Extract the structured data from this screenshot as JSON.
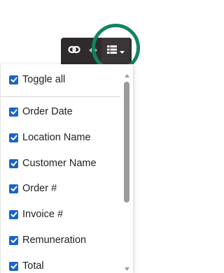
{
  "toolbar": {
    "buttons": [
      {
        "name": "link-toggle",
        "icon": "link-icon"
      },
      {
        "name": "resize",
        "icon": "resize-arrows-icon"
      },
      {
        "name": "column-picker",
        "icon": "grid-icon"
      }
    ]
  },
  "column_menu": {
    "toggle_all": {
      "label": "Toggle all",
      "checked": true
    },
    "columns": [
      {
        "label": "Order Date",
        "checked": true
      },
      {
        "label": "Location Name",
        "checked": true
      },
      {
        "label": "Customer Name",
        "checked": true
      },
      {
        "label": "Order #",
        "checked": true
      },
      {
        "label": "Invoice #",
        "checked": true
      },
      {
        "label": "Remuneration",
        "checked": true
      },
      {
        "label": "Total",
        "checked": true
      }
    ]
  },
  "colors": {
    "toolbar_bg": "#2f2b2c",
    "checkbox": "#1a64c8",
    "highlight_ring": "#12855a"
  }
}
